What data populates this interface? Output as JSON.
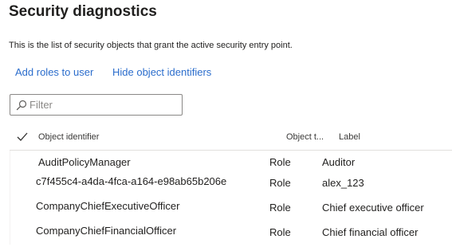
{
  "page": {
    "title": "Security diagnostics",
    "description": "This is the list of security objects that grant the active security entry point."
  },
  "actions": {
    "add_roles_label": "Add roles to user",
    "hide_identifiers_label": "Hide object identifiers"
  },
  "filter": {
    "placeholder": "Filter",
    "value": ""
  },
  "grid": {
    "columns": {
      "object_identifier": "Object identifier",
      "object_type": "Object t...",
      "label": "Label"
    },
    "rows": [
      {
        "object_identifier": "AuditPolicyManager",
        "object_type": "Role",
        "label": "Auditor"
      },
      {
        "object_identifier": "c7f455c4-a4da-4fca-a164-e98ab65b206e",
        "object_type": "Role",
        "label": "alex_123"
      },
      {
        "object_identifier": "CompanyChiefExecutiveOfficer",
        "object_type": "Role",
        "label": "Chief executive officer"
      },
      {
        "object_identifier": "CompanyChiefFinancialOfficer",
        "object_type": "Role",
        "label": "Chief financial officer"
      }
    ]
  },
  "icons": {
    "filter": "search-icon",
    "select_all": "checkmark-icon"
  },
  "colors": {
    "link": "#2b6dcc",
    "text": "#201f1e",
    "border": "#8a8886",
    "divider": "#e1dfdd"
  }
}
